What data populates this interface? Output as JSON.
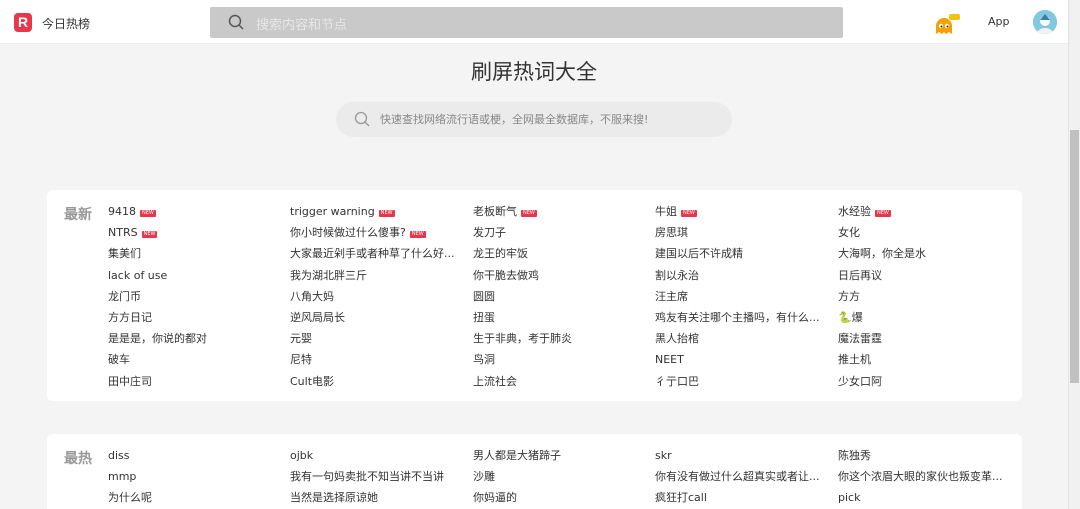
{
  "header": {
    "logo_letter": "R",
    "brand": "今日热榜",
    "search_placeholder": "搜索内容和节点",
    "app_label": "App"
  },
  "hero": {
    "title": "刷屏热词大全",
    "search_placeholder": "快速查找网络流行语或梗，全网最全数据库，不服来搜!"
  },
  "latest": {
    "label": "最新",
    "new_badge": "NEW",
    "items": [
      {
        "text": "9418",
        "new": true
      },
      {
        "text": "trigger warning",
        "new": true
      },
      {
        "text": "老板断气",
        "new": true
      },
      {
        "text": "牛姐",
        "new": true
      },
      {
        "text": "水经验",
        "new": true
      },
      {
        "text": "NTRS",
        "new": true
      },
      {
        "text": "你小时候做过什么傻事?",
        "new": true
      },
      {
        "text": "发刀子",
        "new": false
      },
      {
        "text": "房思琪",
        "new": false
      },
      {
        "text": "女化",
        "new": false
      },
      {
        "text": "集美们",
        "new": false
      },
      {
        "text": "大家最近剁手或者种草了什么好...",
        "new": false
      },
      {
        "text": "龙王的牢饭",
        "new": false
      },
      {
        "text": "建国以后不许成精",
        "new": false
      },
      {
        "text": "大海啊，你全是水",
        "new": false
      },
      {
        "text": "lack of use",
        "new": false
      },
      {
        "text": "我为湖北胖三斤",
        "new": false
      },
      {
        "text": "你干脆去做鸡",
        "new": false
      },
      {
        "text": "割以永治",
        "new": false
      },
      {
        "text": "日后再议",
        "new": false
      },
      {
        "text": "龙门币",
        "new": false
      },
      {
        "text": "八角大妈",
        "new": false
      },
      {
        "text": "圆圆",
        "new": false
      },
      {
        "text": "汪主席",
        "new": false
      },
      {
        "text": "方方",
        "new": false
      },
      {
        "text": "方方日记",
        "new": false
      },
      {
        "text": "逆风局局长",
        "new": false
      },
      {
        "text": "扭蛋",
        "new": false
      },
      {
        "text": "鸡友有关注哪个主播吗，有什么...",
        "new": false
      },
      {
        "text": "🐍爆",
        "new": false
      },
      {
        "text": "是是是，你说的都对",
        "new": false
      },
      {
        "text": "元婴",
        "new": false
      },
      {
        "text": "生于非典，考于肺炎",
        "new": false
      },
      {
        "text": "黑人抬棺",
        "new": false
      },
      {
        "text": "魔法雷霆",
        "new": false
      },
      {
        "text": "破车",
        "new": false
      },
      {
        "text": "尼特",
        "new": false
      },
      {
        "text": "鸟洞",
        "new": false
      },
      {
        "text": "NEET",
        "new": false
      },
      {
        "text": "推土机",
        "new": false
      },
      {
        "text": "田中庄司",
        "new": false
      },
      {
        "text": "Cult电影",
        "new": false
      },
      {
        "text": "上流社会",
        "new": false
      },
      {
        "text": "彳亍口巴",
        "new": false
      },
      {
        "text": "少女口阿",
        "new": false
      }
    ]
  },
  "hottest": {
    "label": "最热",
    "items": [
      {
        "text": "diss"
      },
      {
        "text": "ojbk"
      },
      {
        "text": "男人都是大猪蹄子"
      },
      {
        "text": "skr"
      },
      {
        "text": "陈独秀"
      },
      {
        "text": "mmp"
      },
      {
        "text": "我有一句妈卖批不知当讲不当讲"
      },
      {
        "text": "沙雕"
      },
      {
        "text": "你有没有做过什么超真实或者让..."
      },
      {
        "text": "你这个浓眉大眼的家伙也叛变革..."
      },
      {
        "text": "为什么呢"
      },
      {
        "text": "当然是选择原谅她"
      },
      {
        "text": "你妈逼的"
      },
      {
        "text": "疯狂打call"
      },
      {
        "text": "pick"
      }
    ]
  }
}
